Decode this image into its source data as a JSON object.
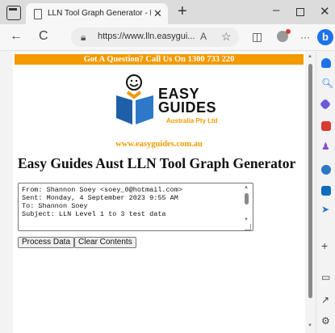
{
  "browser": {
    "tab": {
      "title": "LLN Tool Graph Generator - Easy"
    },
    "new_tab_glyph": "+",
    "window_controls": {
      "minimize": "–",
      "maximize": "",
      "close": "✕"
    },
    "address": {
      "url": "https://www.lln.easygui...",
      "reader_glyph": "A",
      "favorite_glyph": "☆"
    },
    "toolbar_glyphs": {
      "back": "←",
      "refresh": "C",
      "split": "◫",
      "more": "···"
    },
    "bing_label": "b"
  },
  "page": {
    "banner": "Got A Question? Call Us On 1300 733 220",
    "logo": {
      "line1": "EASY",
      "line2": "GUIDES",
      "line3": "Australia Pty Ltd"
    },
    "site_url": "www.easyguides.com.au",
    "heading": "Easy Guides Aust LLN Tool Graph Generator",
    "textarea_value": "From: Shannon Soey <soey_0@hotmail.com>\nSent: Monday, 4 September 2023 9:55 AM\nTo: Shannon Soey\nSubject: LLN Level 1 to 3 test data",
    "buttons": {
      "process": "Process Data",
      "clear": "Clear Contents"
    }
  },
  "sidebar": {
    "icons": [
      "bell-icon",
      "search-icon",
      "tag-icon",
      "briefcase-icon",
      "chess-icon",
      "circle-icon",
      "outlook-icon",
      "send-icon"
    ],
    "add_glyph": "+",
    "bottom_glyphs": {
      "panel": "▭",
      "external": "↗",
      "settings": "⚙"
    }
  },
  "colors": {
    "accent_orange": "#f39a00",
    "brand_blue": "#1a73e8"
  }
}
